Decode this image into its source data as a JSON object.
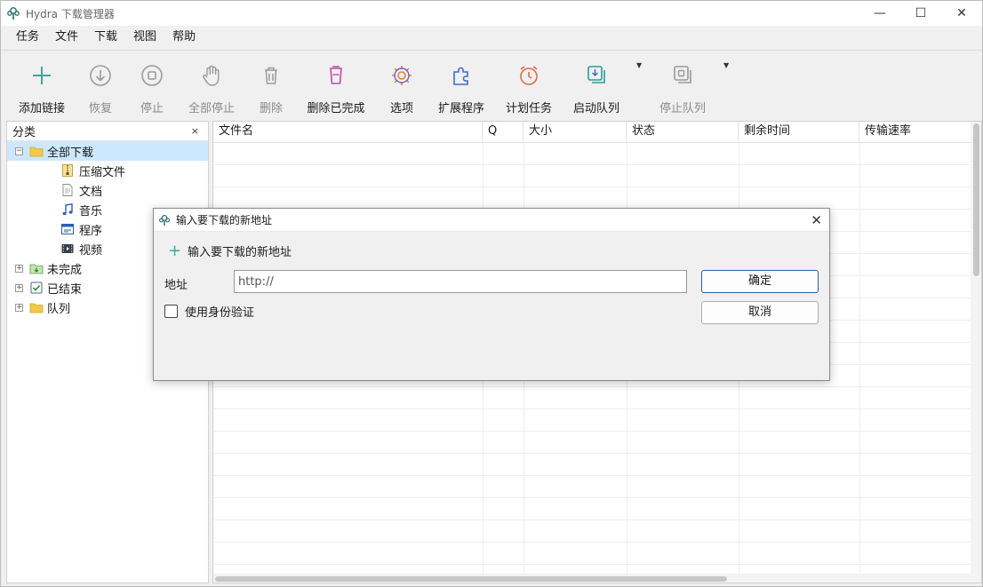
{
  "window": {
    "title": "Hydra 下载管理器"
  },
  "window_controls": {
    "minimize": "—",
    "maximize": "☐",
    "close": "✕"
  },
  "menu": [
    "任务",
    "文件",
    "下载",
    "视图",
    "帮助"
  ],
  "toolbar": {
    "add_link": "添加链接",
    "resume": "恢复",
    "stop": "停止",
    "stop_all": "全部停止",
    "delete": "删除",
    "delete_completed": "删除已完成",
    "options": "选项",
    "extensions": "扩展程序",
    "scheduler": "计划任务",
    "start_queue": "启动队列",
    "stop_queue": "停止队列"
  },
  "colors": {
    "accent_add": "#3aa8a0",
    "accent_queue": "#2a9d9a",
    "selected_row": "#cce8ff",
    "folder": "#f3c94c"
  },
  "sidebar": {
    "header": "分类",
    "close": "×",
    "tree": {
      "all_downloads": "全部下载",
      "compressed": "压缩文件",
      "documents": "文档",
      "music": "音乐",
      "programs": "程序",
      "video": "视频",
      "unfinished": "未完成",
      "finished": "已结束",
      "queue": "队列"
    }
  },
  "table": {
    "columns": [
      "文件名",
      "Q",
      "大小",
      "状态",
      "剩余时间",
      "传输速率"
    ]
  },
  "dialog": {
    "title": "输入要下载的新地址",
    "heading": "输入要下载的新地址",
    "address_label": "地址",
    "address_placeholder": "http://",
    "auth_label": "使用身份验证",
    "ok": "确定",
    "cancel": "取消"
  }
}
